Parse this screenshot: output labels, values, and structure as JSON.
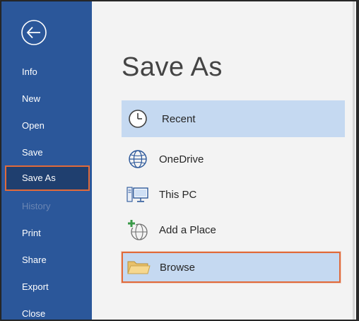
{
  "sidebar": {
    "back_icon": "back-arrow-icon",
    "items": [
      {
        "label": "Info",
        "state": "normal"
      },
      {
        "label": "New",
        "state": "normal"
      },
      {
        "label": "Open",
        "state": "normal"
      },
      {
        "label": "Save",
        "state": "normal"
      },
      {
        "label": "Save As",
        "state": "selected"
      },
      {
        "label": "History",
        "state": "disabled"
      },
      {
        "label": "Print",
        "state": "normal"
      },
      {
        "label": "Share",
        "state": "normal"
      },
      {
        "label": "Export",
        "state": "normal"
      },
      {
        "label": "Close",
        "state": "normal"
      }
    ]
  },
  "main": {
    "title": "Save As",
    "locations": [
      {
        "label": "Recent",
        "icon": "clock-icon",
        "state": "selected"
      },
      {
        "label": "OneDrive",
        "icon": "globe-icon",
        "state": "normal"
      },
      {
        "label": "This PC",
        "icon": "computer-icon",
        "state": "normal"
      },
      {
        "label": "Add a Place",
        "icon": "add-place-icon",
        "state": "normal"
      },
      {
        "label": "Browse",
        "icon": "folder-icon",
        "state": "highlighted"
      }
    ]
  },
  "colors": {
    "sidebar_bg": "#2b579a",
    "selection_bg": "#c5d9f1",
    "highlight_outline": "#e06a3a"
  }
}
